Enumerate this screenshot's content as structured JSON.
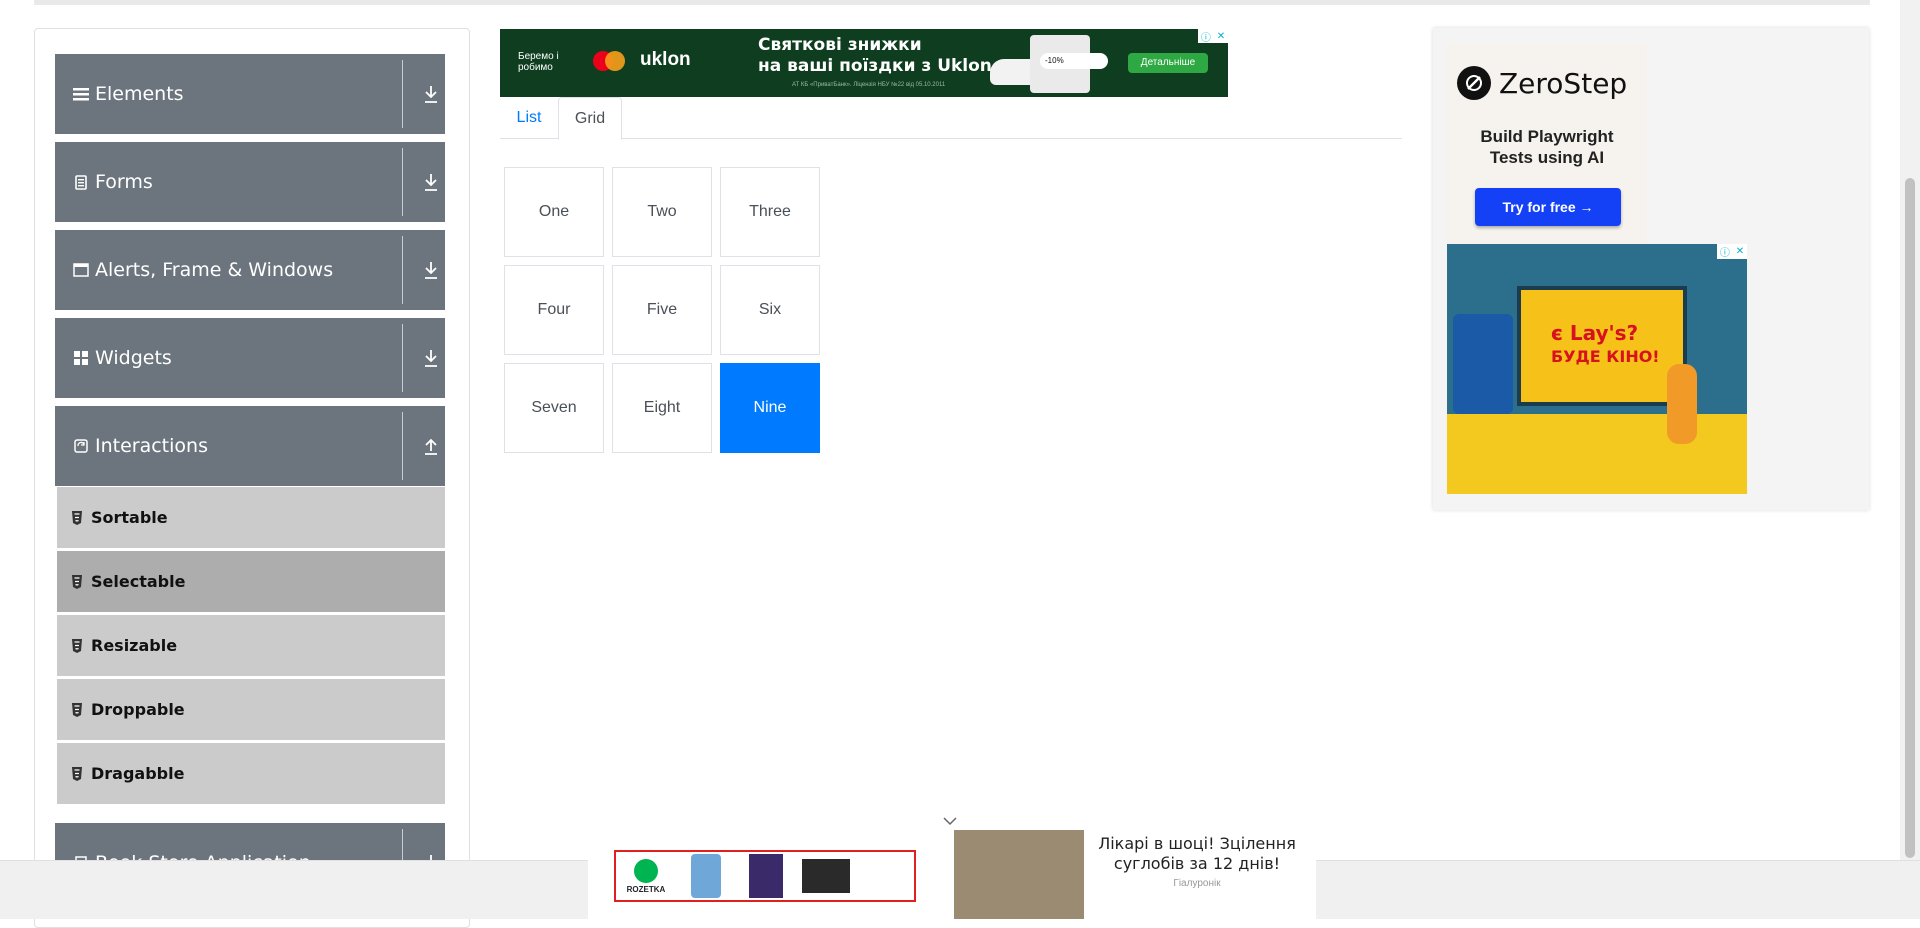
{
  "sidebar": {
    "groups": [
      {
        "label": "Elements",
        "icon": "menu-icon",
        "arrow": "download-icon"
      },
      {
        "label": "Forms",
        "icon": "clipboard-icon",
        "arrow": "download-icon"
      },
      {
        "label": "Alerts, Frame & Windows",
        "icon": "window-icon",
        "arrow": "download-icon"
      },
      {
        "label": "Widgets",
        "icon": "widgets-icon",
        "arrow": "download-icon"
      },
      {
        "label": "Interactions",
        "icon": "refresh-icon",
        "arrow": "upload-icon"
      },
      {
        "label": "Book Store Application",
        "icon": "book-icon",
        "arrow": "download-icon"
      }
    ],
    "interactions": [
      {
        "label": "Sortable"
      },
      {
        "label": "Selectable",
        "active": true
      },
      {
        "label": "Resizable"
      },
      {
        "label": "Droppable"
      },
      {
        "label": "Dragabble"
      }
    ]
  },
  "top_ad": {
    "brand": "Беремо і робимо",
    "partner": "uklon",
    "headline_1": "Святкові знижки",
    "headline_2": "на ваші поїздки з Uklon",
    "fine_print": "АТ КБ «ПриватБанк». Ліцензія НБУ №22 від 05.10.2011",
    "discount": "-10%",
    "cta": "Детальніше"
  },
  "tabs": [
    {
      "label": "List",
      "active": false
    },
    {
      "label": "Grid",
      "active": true
    }
  ],
  "grid": {
    "cells": [
      {
        "label": "One",
        "active": false
      },
      {
        "label": "Two",
        "active": false
      },
      {
        "label": "Three",
        "active": false
      },
      {
        "label": "Four",
        "active": false
      },
      {
        "label": "Five",
        "active": false
      },
      {
        "label": "Six",
        "active": false
      },
      {
        "label": "Seven",
        "active": false
      },
      {
        "label": "Eight",
        "active": false
      },
      {
        "label": "Nine",
        "active": true
      }
    ]
  },
  "right_ad": {
    "brand": "ZeroStep",
    "tagline_1": "Build Playwright",
    "tagline_2": "Tests using AI",
    "cta": "Try for free →",
    "lays_brand": "Lay's",
    "lays_line_1": "є",
    "lays_line_2": "?",
    "lays_line_3": "БУДЕ КІНО!"
  },
  "bottom_ad": {
    "shop": "ROZETKA",
    "title": "Лікарі в шоці! Зцілення суглобів за 12 днів!",
    "source": "Гіалуронік"
  },
  "colors": {
    "sidebar_header": "#6c757d",
    "sidebar_item": "#cbcbcb",
    "sidebar_item_active": "#adadad",
    "accent": "#007bff",
    "zerostep_button": "#1441f5"
  }
}
